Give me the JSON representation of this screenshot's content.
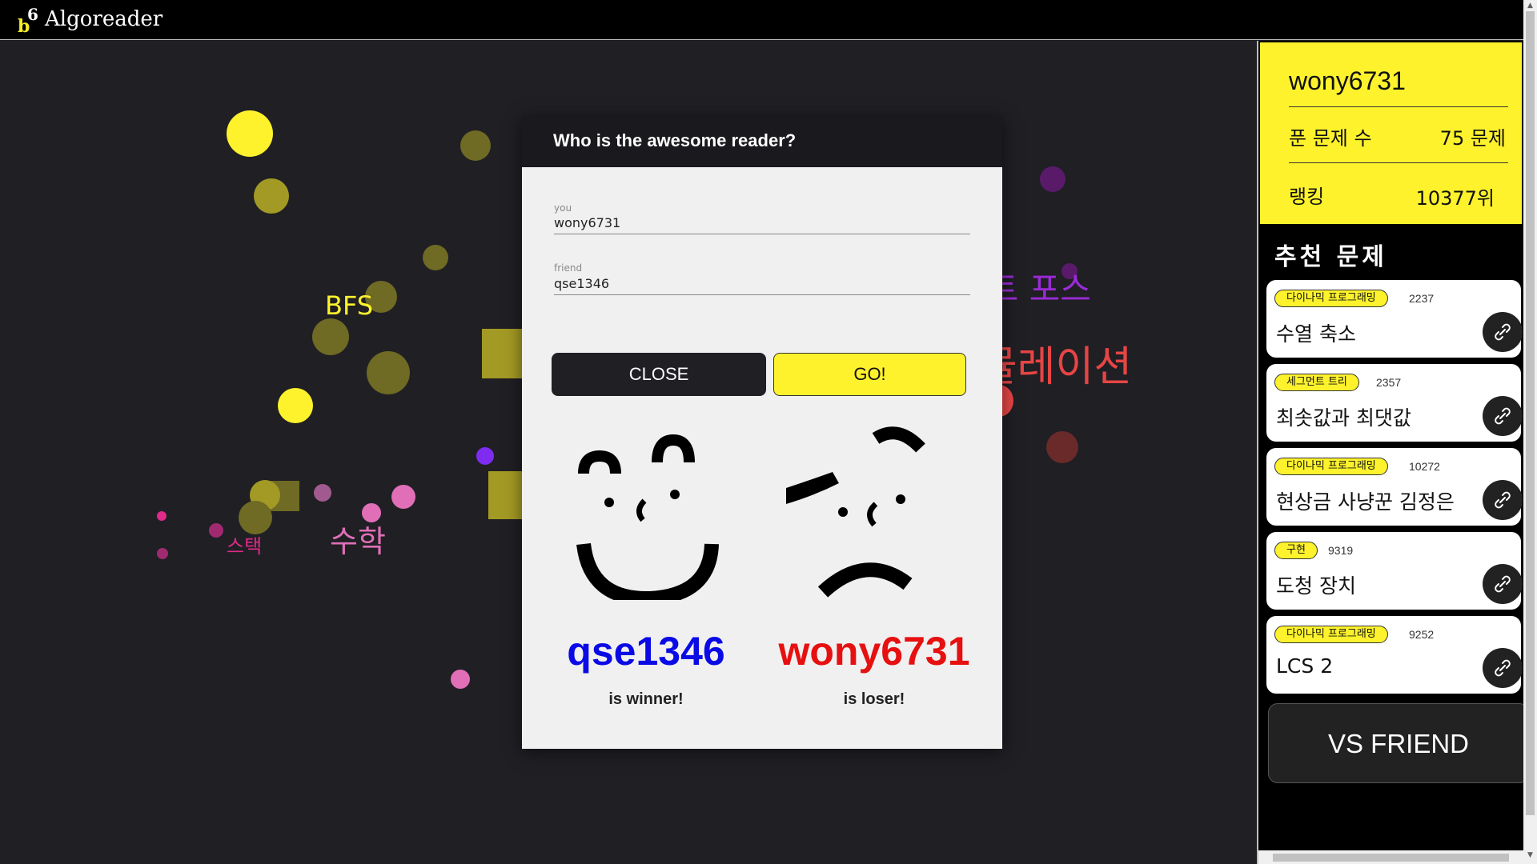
{
  "app": {
    "title": "Algoreader"
  },
  "background_words": [
    {
      "text": "BFS",
      "color": "#fdf22c"
    },
    {
      "text": "스택",
      "color": "#e02a8a"
    },
    {
      "text": "수학",
      "color": "#e06fb8"
    },
    {
      "text": "루트 포스",
      "color": "#9b2bd6"
    },
    {
      "text": "시뮬레이션",
      "color": "#e64545"
    }
  ],
  "profile": {
    "username": "wony6731",
    "solved_label": "푼 문제 수",
    "solved_value": "75 문제",
    "rank_label": "랭킹",
    "rank_value": "10377위"
  },
  "recommend": {
    "title": "추천 문제",
    "items": [
      {
        "tag": "다이나믹 프로그래밍",
        "number": "2237",
        "title": "수열 축소"
      },
      {
        "tag": "세그먼트 트리",
        "number": "2357",
        "title": "최솟값과 최댓값"
      },
      {
        "tag": "다이나믹 프로그래밍",
        "number": "10272",
        "title": "현상금 사냥꾼 김정은"
      },
      {
        "tag": "구현",
        "number": "9319",
        "title": "도청 장치"
      },
      {
        "tag": "다이나믹 프로그래밍",
        "number": "9252",
        "title": "LCS 2"
      }
    ]
  },
  "vs_button": "VS FRIEND",
  "modal": {
    "title": "Who is the awesome reader?",
    "you_label": "you",
    "you_value": "wony6731",
    "friend_label": "friend",
    "friend_value": "qse1346",
    "close_label": "CLOSE",
    "go_label": "GO!",
    "winner_name": "qse1346",
    "winner_text": "is winner!",
    "loser_name": "wony6731",
    "loser_text": "is loser!",
    "winner_color": "#0a0ae6",
    "loser_color": "#e61010"
  }
}
